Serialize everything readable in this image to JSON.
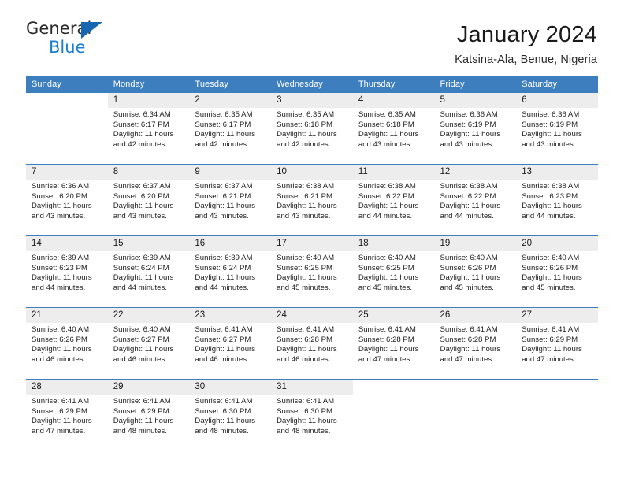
{
  "logo": {
    "word_one": "General",
    "word_two": "Blue",
    "triangle_icon": "triangle-icon",
    "brand_blue": "#1B7FD4",
    "brand_dark_blue": "#1667B0"
  },
  "header": {
    "title": "January 2024",
    "subtitle": "Katsina-Ala, Benue, Nigeria"
  },
  "theme": {
    "header_row_bg": "#3D7EBF",
    "header_row_text": "#FFFFFF",
    "daynum_bg": "#EDEDED",
    "row_separator": "#3D7EBF"
  },
  "calendar": {
    "weekday_headers": [
      "Sunday",
      "Monday",
      "Tuesday",
      "Wednesday",
      "Thursday",
      "Friday",
      "Saturday"
    ],
    "weeks": [
      [
        {
          "day": "",
          "lines": []
        },
        {
          "day": "1",
          "lines": [
            "Sunrise: 6:34 AM",
            "Sunset: 6:17 PM",
            "Daylight: 11 hours",
            "and 42 minutes."
          ]
        },
        {
          "day": "2",
          "lines": [
            "Sunrise: 6:35 AM",
            "Sunset: 6:17 PM",
            "Daylight: 11 hours",
            "and 42 minutes."
          ]
        },
        {
          "day": "3",
          "lines": [
            "Sunrise: 6:35 AM",
            "Sunset: 6:18 PM",
            "Daylight: 11 hours",
            "and 42 minutes."
          ]
        },
        {
          "day": "4",
          "lines": [
            "Sunrise: 6:35 AM",
            "Sunset: 6:18 PM",
            "Daylight: 11 hours",
            "and 43 minutes."
          ]
        },
        {
          "day": "5",
          "lines": [
            "Sunrise: 6:36 AM",
            "Sunset: 6:19 PM",
            "Daylight: 11 hours",
            "and 43 minutes."
          ]
        },
        {
          "day": "6",
          "lines": [
            "Sunrise: 6:36 AM",
            "Sunset: 6:19 PM",
            "Daylight: 11 hours",
            "and 43 minutes."
          ]
        }
      ],
      [
        {
          "day": "7",
          "lines": [
            "Sunrise: 6:36 AM",
            "Sunset: 6:20 PM",
            "Daylight: 11 hours",
            "and 43 minutes."
          ]
        },
        {
          "day": "8",
          "lines": [
            "Sunrise: 6:37 AM",
            "Sunset: 6:20 PM",
            "Daylight: 11 hours",
            "and 43 minutes."
          ]
        },
        {
          "day": "9",
          "lines": [
            "Sunrise: 6:37 AM",
            "Sunset: 6:21 PM",
            "Daylight: 11 hours",
            "and 43 minutes."
          ]
        },
        {
          "day": "10",
          "lines": [
            "Sunrise: 6:38 AM",
            "Sunset: 6:21 PM",
            "Daylight: 11 hours",
            "and 43 minutes."
          ]
        },
        {
          "day": "11",
          "lines": [
            "Sunrise: 6:38 AM",
            "Sunset: 6:22 PM",
            "Daylight: 11 hours",
            "and 44 minutes."
          ]
        },
        {
          "day": "12",
          "lines": [
            "Sunrise: 6:38 AM",
            "Sunset: 6:22 PM",
            "Daylight: 11 hours",
            "and 44 minutes."
          ]
        },
        {
          "day": "13",
          "lines": [
            "Sunrise: 6:38 AM",
            "Sunset: 6:23 PM",
            "Daylight: 11 hours",
            "and 44 minutes."
          ]
        }
      ],
      [
        {
          "day": "14",
          "lines": [
            "Sunrise: 6:39 AM",
            "Sunset: 6:23 PM",
            "Daylight: 11 hours",
            "and 44 minutes."
          ]
        },
        {
          "day": "15",
          "lines": [
            "Sunrise: 6:39 AM",
            "Sunset: 6:24 PM",
            "Daylight: 11 hours",
            "and 44 minutes."
          ]
        },
        {
          "day": "16",
          "lines": [
            "Sunrise: 6:39 AM",
            "Sunset: 6:24 PM",
            "Daylight: 11 hours",
            "and 44 minutes."
          ]
        },
        {
          "day": "17",
          "lines": [
            "Sunrise: 6:40 AM",
            "Sunset: 6:25 PM",
            "Daylight: 11 hours",
            "and 45 minutes."
          ]
        },
        {
          "day": "18",
          "lines": [
            "Sunrise: 6:40 AM",
            "Sunset: 6:25 PM",
            "Daylight: 11 hours",
            "and 45 minutes."
          ]
        },
        {
          "day": "19",
          "lines": [
            "Sunrise: 6:40 AM",
            "Sunset: 6:26 PM",
            "Daylight: 11 hours",
            "and 45 minutes."
          ]
        },
        {
          "day": "20",
          "lines": [
            "Sunrise: 6:40 AM",
            "Sunset: 6:26 PM",
            "Daylight: 11 hours",
            "and 45 minutes."
          ]
        }
      ],
      [
        {
          "day": "21",
          "lines": [
            "Sunrise: 6:40 AM",
            "Sunset: 6:26 PM",
            "Daylight: 11 hours",
            "and 46 minutes."
          ]
        },
        {
          "day": "22",
          "lines": [
            "Sunrise: 6:40 AM",
            "Sunset: 6:27 PM",
            "Daylight: 11 hours",
            "and 46 minutes."
          ]
        },
        {
          "day": "23",
          "lines": [
            "Sunrise: 6:41 AM",
            "Sunset: 6:27 PM",
            "Daylight: 11 hours",
            "and 46 minutes."
          ]
        },
        {
          "day": "24",
          "lines": [
            "Sunrise: 6:41 AM",
            "Sunset: 6:28 PM",
            "Daylight: 11 hours",
            "and 46 minutes."
          ]
        },
        {
          "day": "25",
          "lines": [
            "Sunrise: 6:41 AM",
            "Sunset: 6:28 PM",
            "Daylight: 11 hours",
            "and 47 minutes."
          ]
        },
        {
          "day": "26",
          "lines": [
            "Sunrise: 6:41 AM",
            "Sunset: 6:28 PM",
            "Daylight: 11 hours",
            "and 47 minutes."
          ]
        },
        {
          "day": "27",
          "lines": [
            "Sunrise: 6:41 AM",
            "Sunset: 6:29 PM",
            "Daylight: 11 hours",
            "and 47 minutes."
          ]
        }
      ],
      [
        {
          "day": "28",
          "lines": [
            "Sunrise: 6:41 AM",
            "Sunset: 6:29 PM",
            "Daylight: 11 hours",
            "and 47 minutes."
          ]
        },
        {
          "day": "29",
          "lines": [
            "Sunrise: 6:41 AM",
            "Sunset: 6:29 PM",
            "Daylight: 11 hours",
            "and 48 minutes."
          ]
        },
        {
          "day": "30",
          "lines": [
            "Sunrise: 6:41 AM",
            "Sunset: 6:30 PM",
            "Daylight: 11 hours",
            "and 48 minutes."
          ]
        },
        {
          "day": "31",
          "lines": [
            "Sunrise: 6:41 AM",
            "Sunset: 6:30 PM",
            "Daylight: 11 hours",
            "and 48 minutes."
          ]
        },
        {
          "day": "",
          "lines": []
        },
        {
          "day": "",
          "lines": []
        },
        {
          "day": "",
          "lines": []
        }
      ]
    ]
  }
}
